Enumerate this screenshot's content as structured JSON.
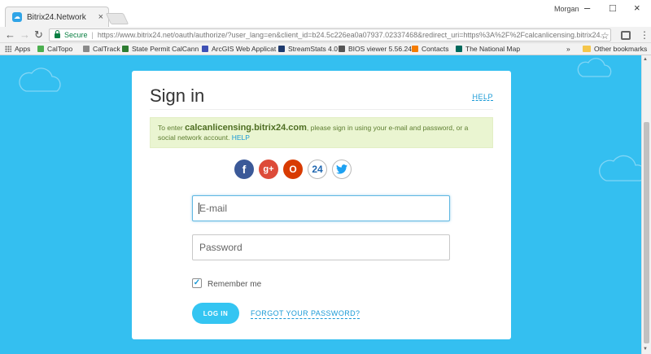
{
  "browser": {
    "tab": {
      "title": "Bitrix24.Network",
      "close": "×"
    },
    "profile_name": "Morgan",
    "window_controls": {
      "minimize": "–",
      "maximize": "□",
      "close": "×"
    },
    "nav": {
      "back": "←",
      "forward": "→",
      "reload": "↻"
    },
    "address": {
      "secure_label": "Secure",
      "url": "https://www.bitrix24.net/oauth/authorize/?user_lang=en&client_id=b24.5c226ea0a07937.02337468&redirect_uri=https%3A%2F%2Fcalcanlicensing.bitrix24..."
    },
    "bookmarks": [
      "Apps",
      "CalTopo",
      "CalTrack",
      "State Permit CalCann",
      "ArcGIS Web Applicat",
      "StreamStats 4.0",
      "BIOS viewer 5.56.24",
      "Contacts",
      "The National Map"
    ],
    "bookmarks_more": "»",
    "other_bookmarks": "Other bookmarks"
  },
  "signin": {
    "title": "Sign in",
    "help_link": "HELP",
    "notice": {
      "prefix": "To enter",
      "domain": "calcanlicensing.bitrix24.com",
      "suffix": ", please sign in using your e-mail and password, or a social network account.",
      "help": "HELP"
    },
    "social_icons": [
      "facebook-icon",
      "google-plus-icon",
      "office365-icon",
      "bitrix24-icon",
      "twitter-icon"
    ],
    "social_glyphs": {
      "facebook": "f",
      "google": "g+",
      "office": "O",
      "bitrix": "24"
    },
    "email_placeholder": "E-mail",
    "password_placeholder": "Password",
    "remember_label": "Remember me",
    "remember_checked": true,
    "login_label": "LOG IN",
    "forgot_label": "FORGOT YOUR PASSWORD?"
  },
  "colors": {
    "page_background": "#34bff0",
    "accent": "#1a9ad6",
    "login_button": "#34c5f2",
    "notice_background": "#eaf5d1",
    "facebook": "#3b5998",
    "google": "#dd4b39",
    "office": "#d83b01"
  }
}
